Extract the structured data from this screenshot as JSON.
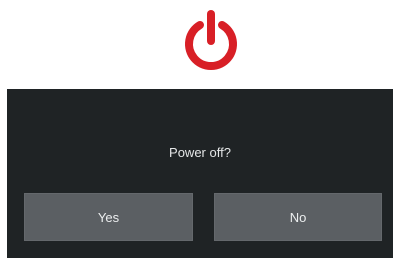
{
  "icon": {
    "name": "power-icon",
    "color": "#d81f26"
  },
  "dialog": {
    "prompt": "Power off?",
    "yes_label": "Yes",
    "no_label": "No"
  },
  "colors": {
    "dialog_bg": "#1f2325",
    "button_bg": "#5b5f63",
    "text": "#e4e6e7"
  }
}
